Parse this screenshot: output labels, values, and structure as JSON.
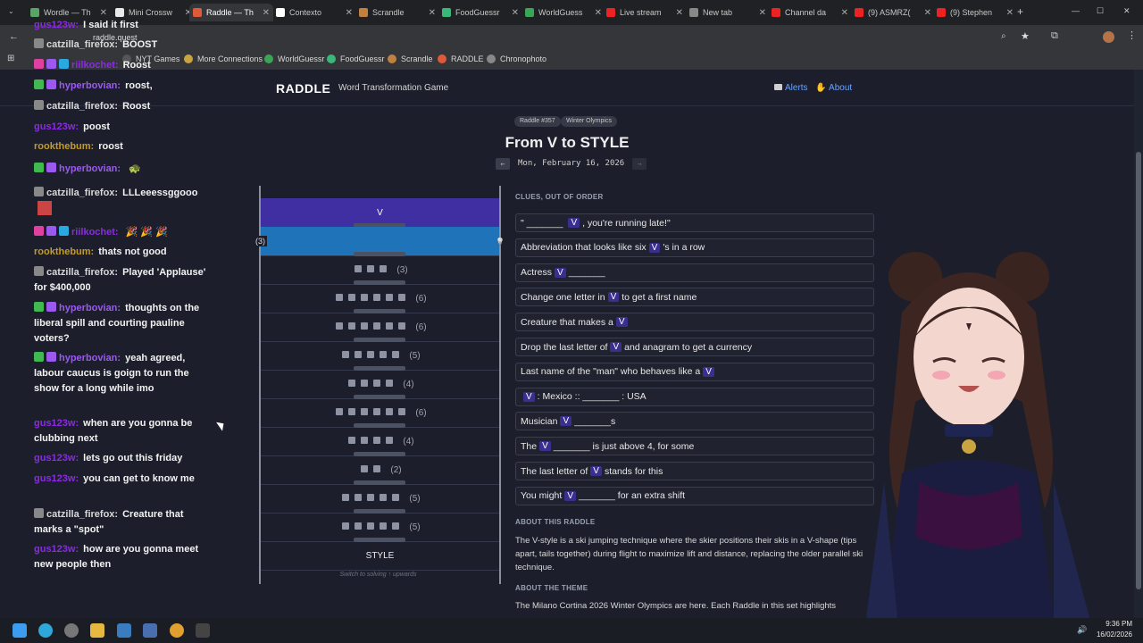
{
  "browser": {
    "tabs": [
      {
        "label": "Wordle — Th",
        "color": "#5aa468"
      },
      {
        "label": "Mini Crossw",
        "color": "#e8e8e8"
      },
      {
        "label": "Raddle — Th",
        "color": "#e05a3a"
      },
      {
        "label": "Contexto",
        "color": "#ffffff"
      },
      {
        "label": "Scrandle",
        "color": "#c08040"
      },
      {
        "label": "FoodGuessr",
        "color": "#39b87a"
      },
      {
        "label": "WorldGuess",
        "color": "#3aa655"
      },
      {
        "label": "Live stream",
        "color": "#e22"
      },
      {
        "label": "New tab",
        "color": "#888"
      },
      {
        "label": "Channel da",
        "color": "#e22"
      },
      {
        "label": "(9) ASMRZ(",
        "color": "#e22"
      },
      {
        "label": "(9) Stephen",
        "color": "#e22"
      }
    ],
    "url": "raddle.quest",
    "bookmarks": [
      "NYT Games",
      "More Connections",
      "WorldGuessr",
      "FoodGuessr",
      "Scrandle",
      "RADDLE",
      "Chronophoto"
    ]
  },
  "site": {
    "logo": "RADDLE",
    "tagline": "Word Transformation Game",
    "alerts": "Alerts",
    "about": "About"
  },
  "puzzle": {
    "pill_number": "Raddle #357",
    "pill_theme": "Winter Olympics",
    "title": "From V to STYLE",
    "date": "Mon, February 16, 2026",
    "start": "V",
    "end": "STYLE",
    "active_count": "(3)",
    "rungs": [
      3,
      6,
      6,
      5,
      4,
      6,
      4,
      2,
      5,
      5
    ],
    "note": "Switch to solving ↑ upwards"
  },
  "clues": {
    "header": "CLUES, OUT OF ORDER",
    "items": [
      {
        "pre": "\" _______ ",
        "post": ", you're running late!\""
      },
      {
        "pre": "Abbreviation that looks like six ",
        "post": "'s in a row"
      },
      {
        "pre": "Actress ",
        "post": " _______"
      },
      {
        "pre": "Change one letter in ",
        "post": " to get a first name"
      },
      {
        "pre": "Creature that makes a ",
        "post": ""
      },
      {
        "pre": "Drop the last letter of ",
        "post": " and anagram to get a currency"
      },
      {
        "pre": "Last name of the \"man\" who behaves like a ",
        "post": ""
      },
      {
        "pre": "",
        "post": " : Mexico :: _______ : USA"
      },
      {
        "pre": "Musician ",
        "post": " _______s"
      },
      {
        "pre": "The ",
        "post": " _______ is just above 4, for some"
      },
      {
        "pre": "The last letter of ",
        "post": " stands for this"
      },
      {
        "pre": "You might ",
        "post": " _______ for an extra shift"
      }
    ],
    "v": "V"
  },
  "about": {
    "header": "ABOUT THIS RADDLE",
    "text": "The V-style is a ski jumping technique where the skier positions their skis in a V-shape (tips apart, tails together) during flight to maximize lift and distance, replacing the older parallel ski technique.",
    "theme_header": "ABOUT THE THEME",
    "theme_text": "The Milano Cortina 2026 Winter Olympics are here. Each Raddle in this set highlights"
  },
  "chat": [
    {
      "user": "gus123w:",
      "text": "I said it first",
      "cls": "u-gus"
    },
    {
      "user": "catzilla_firefox:",
      "text": "BOOST",
      "cls": "u-cat"
    },
    {
      "user": "riilkochet:",
      "text": "Roost",
      "cls": "u-rii"
    },
    {
      "user": "hyperbovian:",
      "text": "roost,",
      "cls": "u-hyp"
    },
    {
      "user": "catzilla_firefox:",
      "text": "Roost",
      "cls": "u-cat"
    },
    {
      "user": "gus123w:",
      "text": "poost",
      "cls": "u-gus"
    },
    {
      "user": "rookthebum:",
      "text": "roost",
      "cls": "u-rook"
    },
    {
      "user": "hyperbovian:",
      "text": "",
      "cls": "u-hyp"
    },
    {
      "user": "catzilla_firefox:",
      "text": "LLLeeessggooo",
      "cls": "u-cat"
    },
    {
      "user": "riilkochet:",
      "text": "",
      "cls": "u-rii"
    },
    {
      "user": "rookthebum:",
      "text": "thats not good",
      "cls": "u-rook"
    },
    {
      "user": "catzilla_firefox:",
      "text": "Played 'Applause' for $400,000",
      "cls": "u-cat"
    },
    {
      "user": "hyperbovian:",
      "text": "thoughts on the liberal spill and courting pauline voters?",
      "cls": "u-hyp"
    },
    {
      "user": "hyperbovian:",
      "text": "yeah agreed, labour caucus is goign to run the show for a long while imo",
      "cls": "u-hyp"
    },
    {
      "user": "gus123w:",
      "text": "when are you gonna be clubbing next",
      "cls": "u-gus"
    },
    {
      "user": "gus123w:",
      "text": "lets go out this friday",
      "cls": "u-gus"
    },
    {
      "user": "gus123w:",
      "text": "you can get to know me",
      "cls": "u-gus"
    },
    {
      "user": "catzilla_firefox:",
      "text": "Creature that marks a \"spot\"",
      "cls": "u-cat"
    },
    {
      "user": "gus123w:",
      "text": "how are you gonna meet new people then",
      "cls": "u-gus"
    }
  ],
  "clock": {
    "time": "9:36 PM",
    "date": "16/02/2026"
  },
  "colors": {
    "accent": "#3f2fa3",
    "active": "#1f73b8",
    "link": "#6aa2ff"
  }
}
